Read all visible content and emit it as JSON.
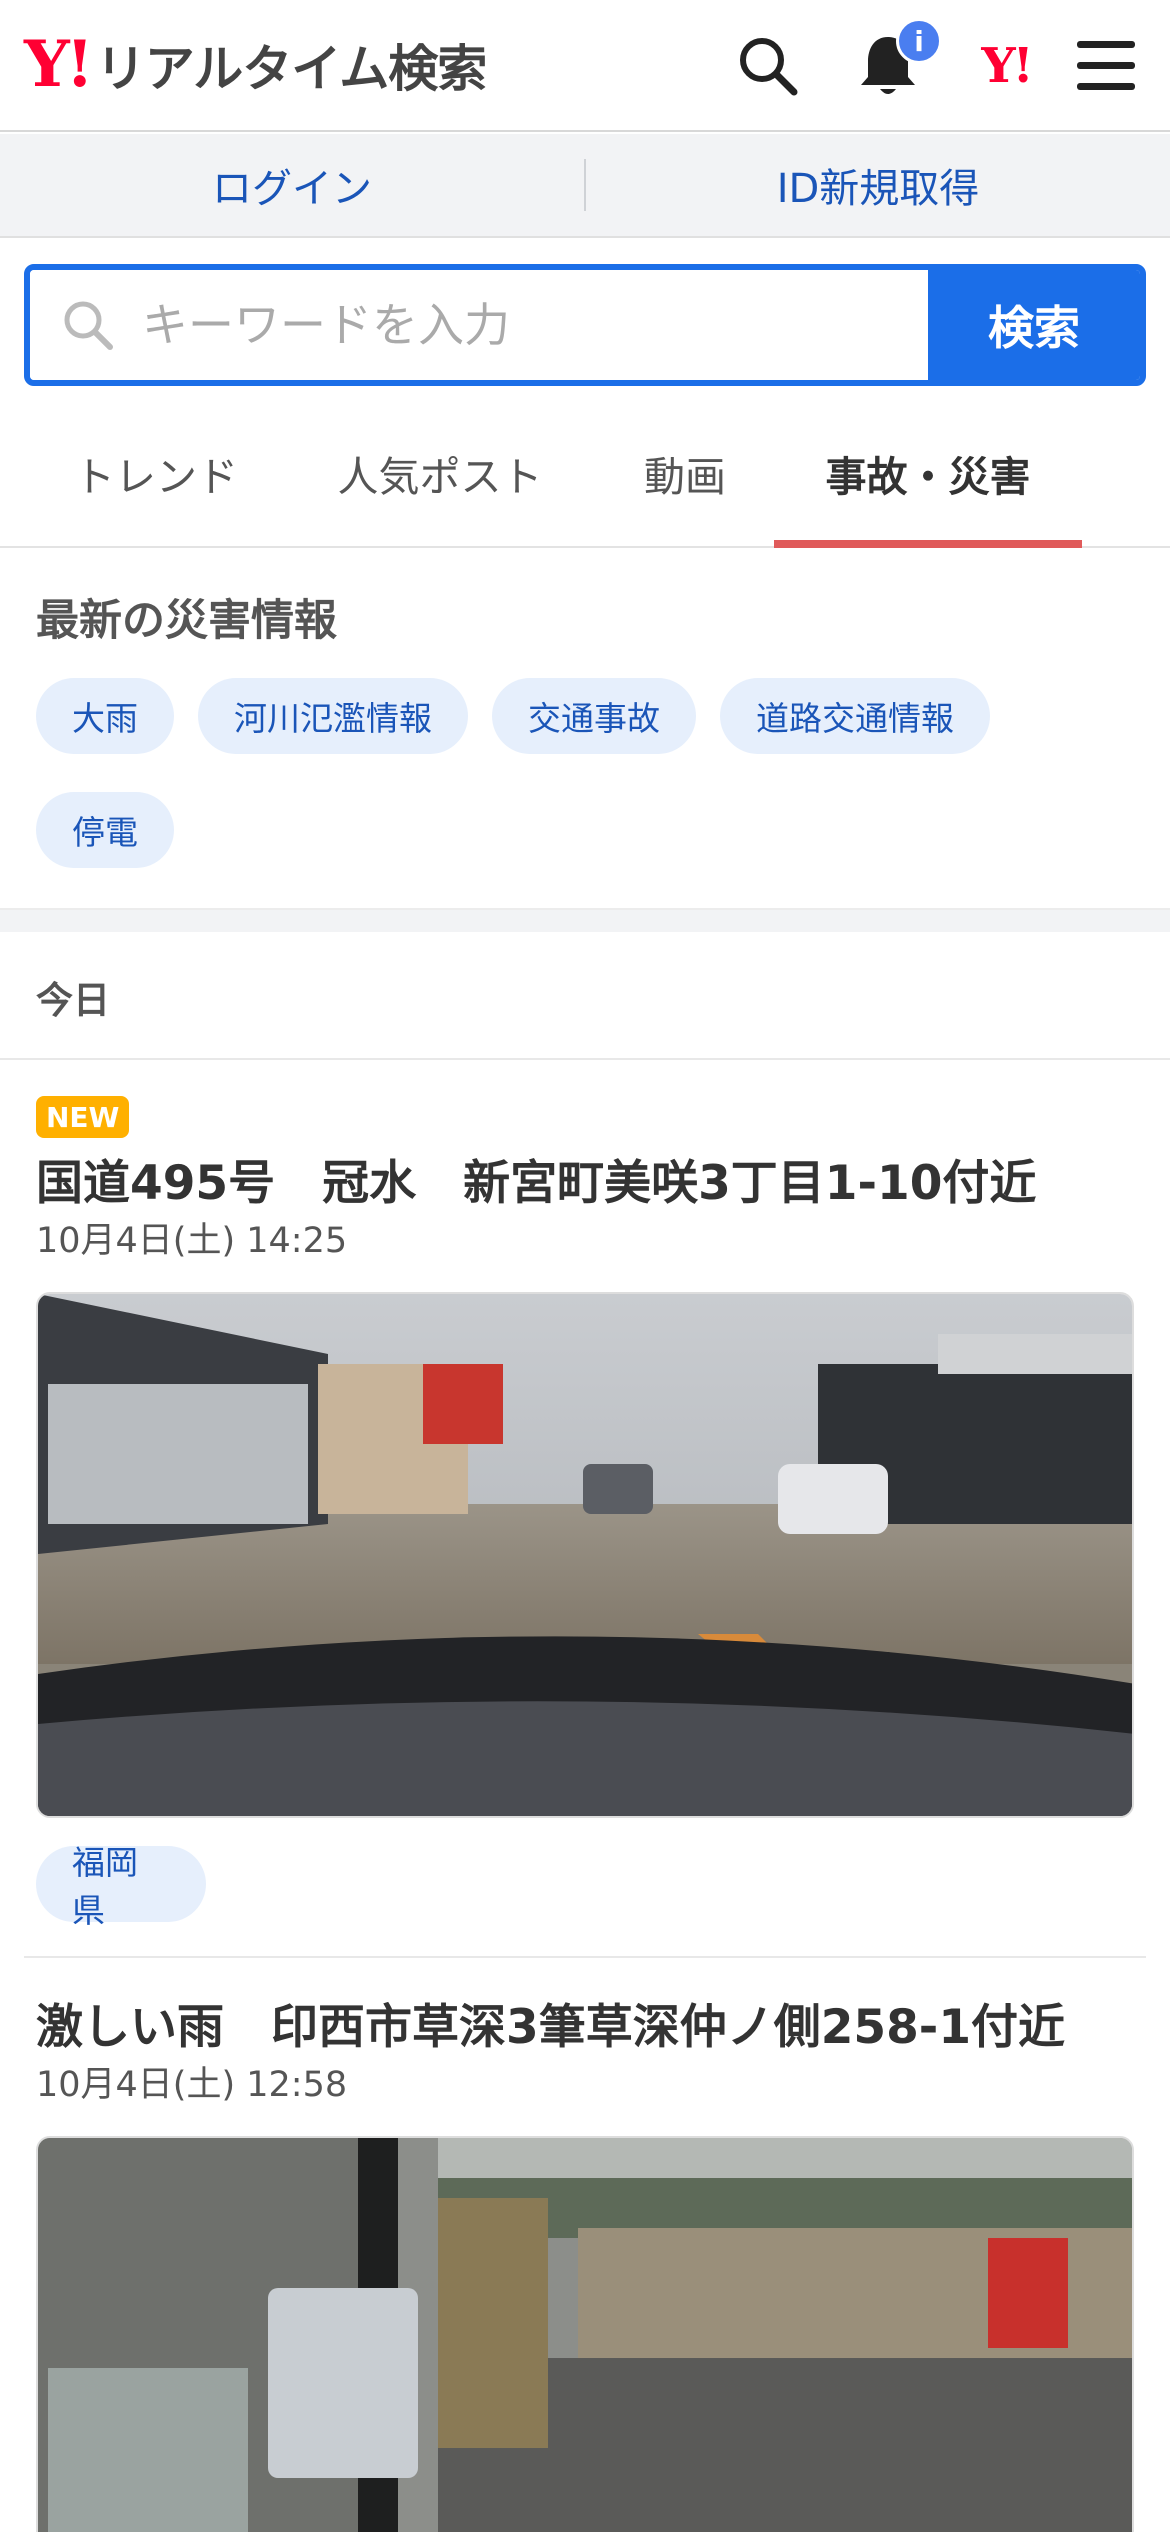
{
  "header": {
    "logo_mark": "Y!",
    "logo_text": "リアルタイム検索",
    "notification_badge": "i",
    "yj_mark": "Y!"
  },
  "loginbar": {
    "login": "ログイン",
    "register": "ID新規取得"
  },
  "search": {
    "placeholder": "キーワードを入力",
    "button": "検索"
  },
  "tabs": [
    {
      "label": "トレンド"
    },
    {
      "label": "人気ポスト"
    },
    {
      "label": "動画"
    },
    {
      "label": "事故・災害",
      "active": true
    }
  ],
  "disaster": {
    "title": "最新の災害情報",
    "chips": [
      "大雨",
      "河川氾濫情報",
      "交通事故",
      "道路交通情報",
      "停電"
    ]
  },
  "today_label": "今日",
  "posts": [
    {
      "badge": "NEW",
      "title": "国道495号　冠水　新宮町美咲3丁目1-10付近",
      "date": "10月4日(土) 14:25",
      "tag": "福岡県"
    },
    {
      "title": "激しい雨　印西市草深3筆草深仲ノ側258-1付近",
      "date": "10月4日(土) 12:58"
    }
  ],
  "colors": {
    "brand_red": "#ff0033",
    "accent_blue": "#1b6ee8",
    "active_tab_underline": "#e05a5a",
    "new_badge": "#ffb000"
  }
}
